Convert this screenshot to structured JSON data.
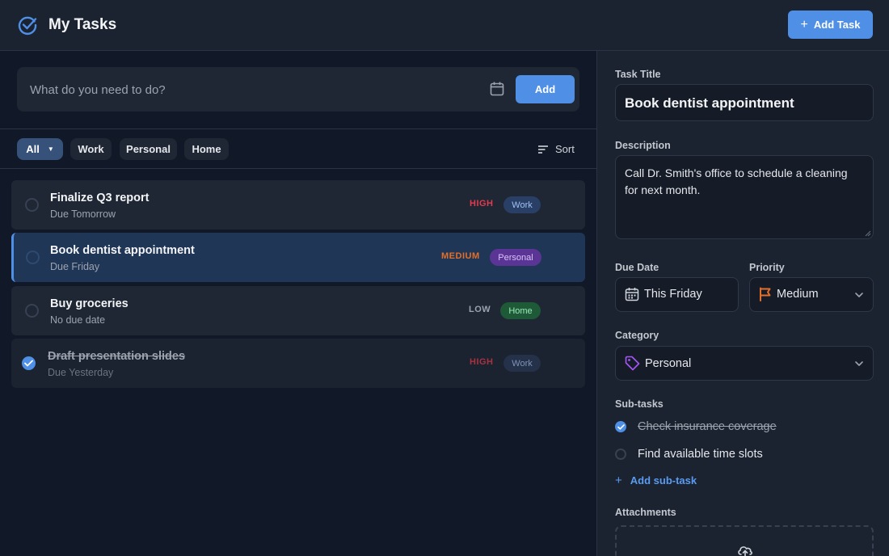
{
  "header": {
    "title": "My Tasks",
    "add_task_label": "Add Task"
  },
  "new_task": {
    "placeholder": "What do you need to do?",
    "add_label": "Add"
  },
  "filters": {
    "chips": [
      "All",
      "Work",
      "Personal",
      "Home"
    ],
    "sort_label": "Sort"
  },
  "tasks": [
    {
      "title": "Finalize Q3 report",
      "due": "Due Tomorrow",
      "priority": "HIGH",
      "category": "Work",
      "completed": false,
      "selected": false
    },
    {
      "title": "Book dentist appointment",
      "due": "Due Friday",
      "priority": "MEDIUM",
      "category": "Personal",
      "completed": false,
      "selected": true
    },
    {
      "title": "Buy groceries",
      "due": "No due date",
      "priority": "LOW",
      "category": "Home",
      "completed": false,
      "selected": false
    },
    {
      "title": "Draft presentation slides",
      "due": "Due Yesterday",
      "priority": "HIGH",
      "category": "Work",
      "completed": true,
      "selected": false
    }
  ],
  "detail": {
    "title_label": "Task Title",
    "title_value": "Book dentist appointment",
    "description_label": "Description",
    "description_value": "Call Dr. Smith's office to schedule a cleaning for next month.",
    "due_label": "Due Date",
    "due_value": "This Friday",
    "priority_label": "Priority",
    "priority_value": "Medium",
    "category_label": "Category",
    "category_value": "Personal",
    "subtasks_label": "Sub-tasks",
    "subtasks": [
      {
        "label": "Check insurance coverage",
        "done": true
      },
      {
        "label": "Find available time slots",
        "done": false
      }
    ],
    "add_subtask_label": "Add sub-task",
    "attachments_label": "Attachments"
  },
  "colors": {
    "accent": "#4f8fe6",
    "priority_high": "#e23b4e",
    "priority_medium": "#e2702a",
    "priority_low": "#9ca3af",
    "work_badge": "#2a3f66",
    "personal_badge": "#5b3596",
    "home_badge": "#1e5a38"
  }
}
